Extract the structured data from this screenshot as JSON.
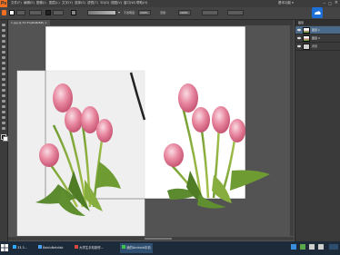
{
  "menubar": {
    "logo": "Ps",
    "items": [
      "文件(F)",
      "编辑(E)",
      "图像(I)",
      "图层(L)",
      "文字(Y)",
      "选择(S)",
      "滤镜(T)",
      "3D(D)",
      "视图(V)",
      "窗口(W)",
      "帮助(H)"
    ],
    "right_text": "基本功能 ▾"
  },
  "options": {
    "opacity_label": "不透明度:",
    "opacity_value": "100%",
    "flow_label": "流量:",
    "flow_value": "100%",
    "fill_color": "#ffffff"
  },
  "tab": {
    "label": "1.jpg @ 33.3%(RGB/8#)"
  },
  "layers_panel": {
    "title": "图层",
    "layers": [
      {
        "name": "图层 1"
      },
      {
        "name": "图层 2"
      },
      {
        "name": "背景"
      }
    ]
  },
  "taskbar": {
    "tasks": [
      {
        "label": "33.3..."
      },
      {
        "label": "BaiduNetdisk"
      },
      {
        "label": "大学生手机制作..."
      },
      {
        "label": "我的Android手机"
      }
    ]
  },
  "colors": {
    "accent": "#f37021",
    "tulip_pink": "#e8879f",
    "leaf_green": "#5c8a2e",
    "taskbar": "#1c2a3a"
  }
}
